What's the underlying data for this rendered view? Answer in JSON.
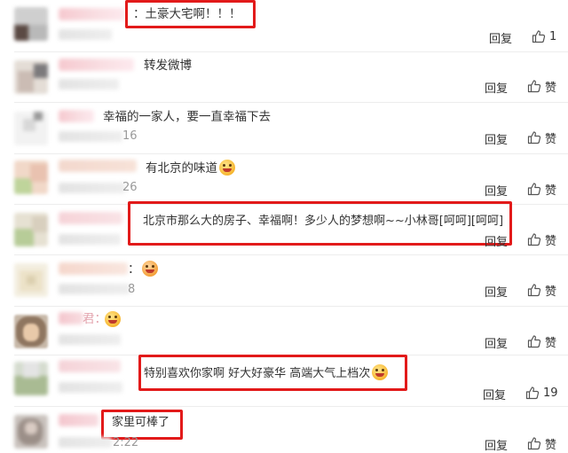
{
  "comments": [
    {
      "text": "：土豪大宅啊！！！",
      "reply": "回复",
      "like": "1",
      "ts_tail": "",
      "emoji": false
    },
    {
      "text": "转发微博",
      "reply": "回复",
      "like": "赞",
      "ts_tail": "",
      "emoji": false
    },
    {
      "text": "幸福的一家人，要一直幸福下去",
      "reply": "回复",
      "like": "赞",
      "ts_tail": "16",
      "emoji": false
    },
    {
      "text": "有北京的味道",
      "reply": "回复",
      "like": "赞",
      "ts_tail": "26",
      "emoji": true
    },
    {
      "text": "北京市那么大的房子、幸福啊！多少人的梦想啊~~小林哥[呵呵][呵呵]",
      "reply": "回复",
      "like": "赞",
      "ts_tail": "",
      "emoji": false
    },
    {
      "text": "：",
      "reply": "回复",
      "like": "赞",
      "ts_tail": "8",
      "emoji": true
    },
    {
      "text": "",
      "reply": "回复",
      "like": "赞",
      "ts_tail": "",
      "emoji": true
    },
    {
      "text": "特别喜欢你家啊 好大好豪华 高端大气上档次",
      "reply": "回复",
      "like": "19",
      "ts_tail": "",
      "emoji": true
    },
    {
      "text": "家里可棒了",
      "reply": "回复",
      "like": "赞",
      "ts_tail": "2:22",
      "emoji": false
    }
  ],
  "fragments": {
    "row3_name_tail": "：",
    "row7_name_tail": "君："
  },
  "colors": {
    "highlight_box": "#e21a1a",
    "text": "#333333",
    "muted": "#9a9a9a"
  },
  "icons": {
    "like": "thumbs-up-icon"
  }
}
